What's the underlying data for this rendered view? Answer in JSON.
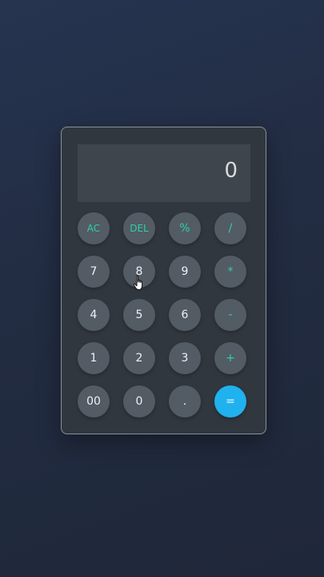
{
  "display": {
    "value": "0"
  },
  "keys": {
    "ac": "AC",
    "del": "DEL",
    "percent": "%",
    "divide": "/",
    "seven": "7",
    "eight": "8",
    "nine": "9",
    "multiply": "*",
    "four": "4",
    "five": "5",
    "six": "6",
    "minus": "-",
    "one": "1",
    "two": "2",
    "three": "3",
    "plus": "+",
    "double_zero": "00",
    "zero": "0",
    "dot": ".",
    "equals": "="
  },
  "colors": {
    "accent": "#2fd0a6",
    "equals": "#1fb2ef",
    "key": "#535b64",
    "panel": "#30373f"
  },
  "icons": {
    "cursor": "hand-pointer-icon"
  }
}
